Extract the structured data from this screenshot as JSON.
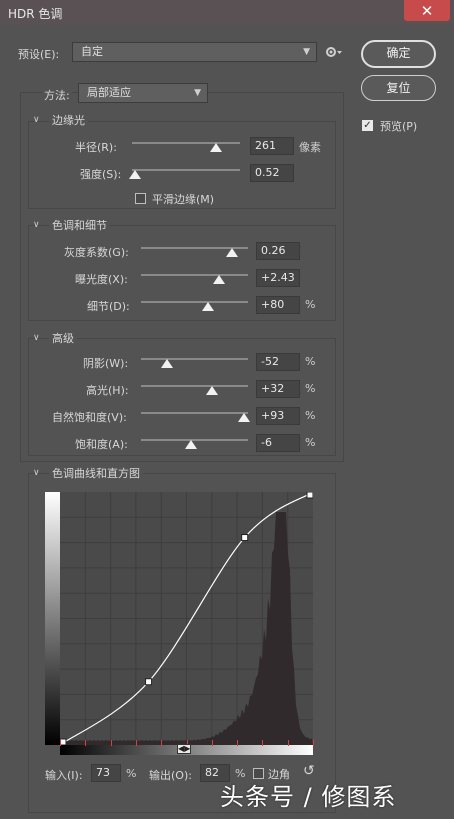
{
  "window": {
    "title": "HDR 色调",
    "close_glyph": "✕"
  },
  "preset": {
    "label": "预设(E):",
    "value": "自定"
  },
  "method": {
    "label": "方法:",
    "value": "局部适应"
  },
  "buttons": {
    "ok": "确定",
    "reset": "复位"
  },
  "preview": {
    "label": "预览(P)",
    "checked": true
  },
  "edge_glow": {
    "title": "边缘光",
    "radius": {
      "label": "半径(R):",
      "value": "261",
      "unit": "像素",
      "fraction": 0.78
    },
    "strength": {
      "label": "强度(S):",
      "value": "0.52",
      "fraction": 0.03
    },
    "smooth_edges": {
      "label": "平滑边缘(M)",
      "checked": false
    }
  },
  "tone_detail": {
    "title": "色调和细节",
    "gamma": {
      "label": "灰度系数(G):",
      "value": "0.26",
      "fraction": 0.85
    },
    "exposure": {
      "label": "曝光度(X):",
      "value": "+2.43",
      "fraction": 0.73
    },
    "detail": {
      "label": "细节(D):",
      "value": "+80",
      "unit": "%",
      "fraction": 0.63
    }
  },
  "advanced": {
    "title": "高级",
    "shadow": {
      "label": "阴影(W):",
      "value": "-52",
      "unit": "%",
      "fraction": 0.24
    },
    "highlight": {
      "label": "高光(H):",
      "value": "+32",
      "unit": "%",
      "fraction": 0.66
    },
    "vibrance": {
      "label": "自然饱和度(V):",
      "value": "+93",
      "unit": "%",
      "fraction": 0.96
    },
    "saturation": {
      "label": "饱和度(A):",
      "value": "-6",
      "unit": "%",
      "fraction": 0.47
    }
  },
  "curve": {
    "title": "色调曲线和直方图",
    "input_label": "输入(I):",
    "input_value": "73",
    "input_unit": "%",
    "output_label": "输出(O):",
    "output_value": "82",
    "output_unit": "%",
    "corner_label": "边角",
    "points": [
      [
        0,
        0
      ],
      [
        0.35,
        0.25
      ],
      [
        0.73,
        0.82
      ],
      [
        1,
        1
      ]
    ]
  },
  "watermark": "头条号 / 修图系",
  "colors": {
    "window_bg": "#535353",
    "title_bg": "#5a5154",
    "close": "#c74b4b",
    "histogram": "#302a2c",
    "curve": "#ffffff"
  }
}
